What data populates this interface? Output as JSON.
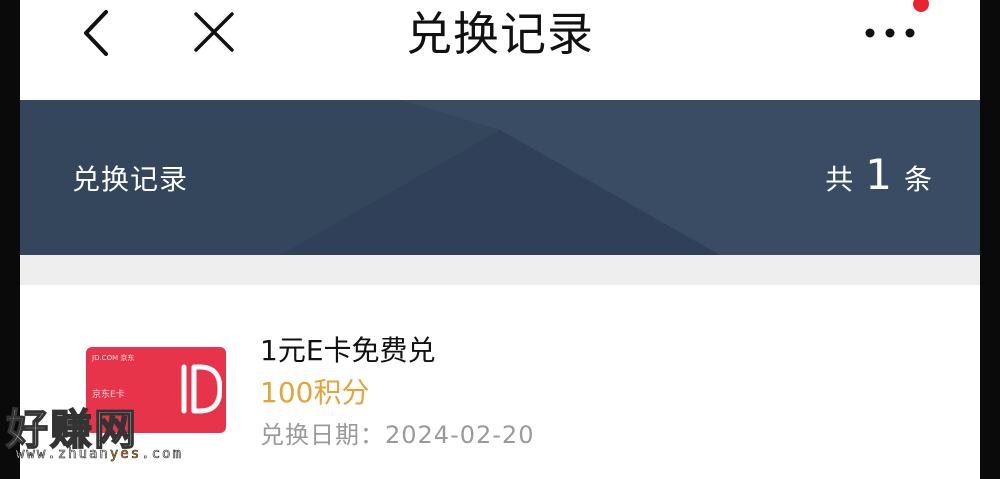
{
  "nav": {
    "title": "兑换记录",
    "back_icon": "chevron-left-icon",
    "close_icon": "close-icon",
    "more_icon": "more-horizontal-icon",
    "notification_dot_color": "#e8242e"
  },
  "banner": {
    "title": "兑换记录",
    "count_prefix": "共",
    "count": "1",
    "count_suffix": "条",
    "background_color": "#33445a"
  },
  "records": [
    {
      "title": "1元E卡免费兑",
      "points": "100积分",
      "date": "兑换日期：2024-02-20",
      "card": {
        "brand": "JD.COM 京东",
        "label": "京东E卡",
        "color": "#e8344a"
      }
    }
  ],
  "watermark": {
    "text": "好赚网",
    "url_prefix": "www.zhuan",
    "url_highlight": "yes",
    "url_suffix": ".com"
  }
}
